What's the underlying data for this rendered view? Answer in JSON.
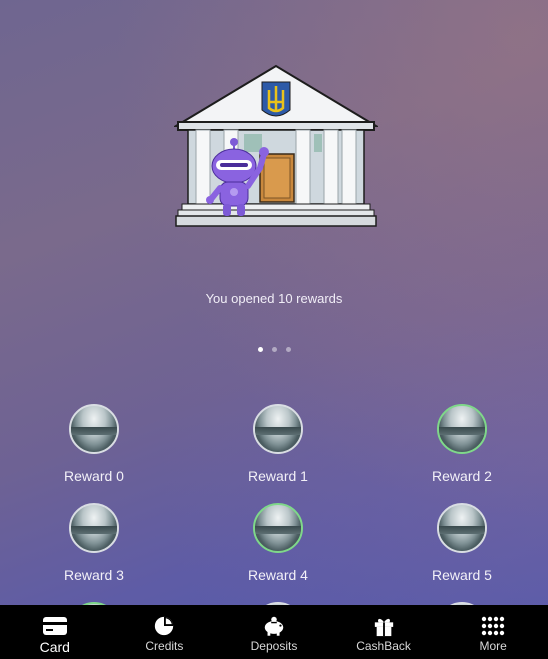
{
  "hero": {
    "caption": "You opened 10 rewards"
  },
  "carousel": {
    "page_count": 3,
    "active_index": 0
  },
  "rewards": [
    {
      "label": "Reward 0",
      "highlighted": false
    },
    {
      "label": "Reward 1",
      "highlighted": false
    },
    {
      "label": "Reward 2",
      "highlighted": true
    },
    {
      "label": "Reward 3",
      "highlighted": false
    },
    {
      "label": "Reward 4",
      "highlighted": true
    },
    {
      "label": "Reward 5",
      "highlighted": false
    }
  ],
  "navbar": {
    "items": [
      {
        "label": "Card",
        "icon": "credit-card-icon",
        "active": true
      },
      {
        "label": "Credits",
        "icon": "pie-chart-icon",
        "active": false
      },
      {
        "label": "Deposits",
        "icon": "piggy-bank-icon",
        "active": false
      },
      {
        "label": "CashBack",
        "icon": "gift-icon",
        "active": false
      },
      {
        "label": "More",
        "icon": "grid-dots-icon",
        "active": false
      }
    ]
  },
  "colors": {
    "highlight_ring": "#7fd88a",
    "navbar_bg": "#000000"
  }
}
